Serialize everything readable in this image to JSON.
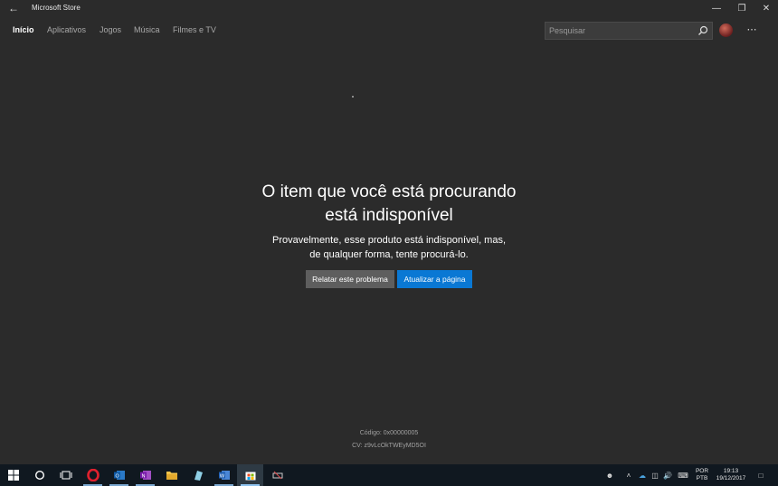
{
  "window": {
    "title": "Microsoft Store"
  },
  "nav": {
    "items": [
      {
        "label": "Início",
        "active": true
      },
      {
        "label": "Aplicativos"
      },
      {
        "label": "Jogos"
      },
      {
        "label": "Música"
      },
      {
        "label": "Filmes e TV"
      }
    ]
  },
  "search": {
    "placeholder": "Pesquisar"
  },
  "error": {
    "title_line1": "O item que você está procurando",
    "title_line2": "está indisponível",
    "message_line1": "Provavelmente, esse produto está indisponível, mas,",
    "message_line2": "de qualquer forma, tente procurá-lo.",
    "report_button": "Relatar este problema",
    "refresh_button": "Atualizar a página",
    "code": "Código: 0x00000005",
    "cv": "CV: z9vLcOkTWEyMD5OI"
  },
  "taskbar": {
    "language_line1": "POR",
    "language_line2": "PTB",
    "time": "19:13",
    "date": "19/12/2017"
  },
  "colors": {
    "accent": "#0a78d4",
    "background": "#2b2b2b",
    "taskbar": "#101820"
  }
}
